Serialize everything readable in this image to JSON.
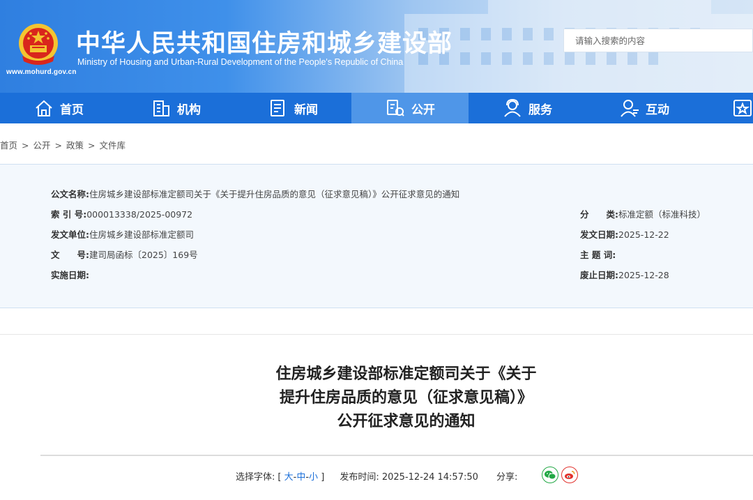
{
  "header": {
    "title_cn": "中华人民共和国住房和城乡建设部",
    "title_en": "Ministry of Housing and Urban-Rural Development of the People's Republic of China",
    "site_url": "www.mohurd.gov.cn",
    "search_placeholder": "请输入搜索的内容"
  },
  "nav": {
    "items": [
      {
        "label": "首页",
        "icon": "home-icon"
      },
      {
        "label": "机构",
        "icon": "building-icon"
      },
      {
        "label": "新闻",
        "icon": "news-icon"
      },
      {
        "label": "公开",
        "icon": "open-doc-icon",
        "active": true
      },
      {
        "label": "服务",
        "icon": "service-user-icon"
      },
      {
        "label": "互动",
        "icon": "interact-user-icon"
      }
    ]
  },
  "breadcrumb": [
    "首页",
    "公开",
    "政策",
    "文件库"
  ],
  "breadcrumb_sep": ">",
  "info": {
    "doc_name_label": "公文名称:",
    "doc_name": "住房城乡建设部标准定额司关于《关于提升住房品质的意见（征求意见稿）》公开征求意见的通知",
    "index_label": "索 引 号:",
    "index": "000013338/2025-00972",
    "category_label": "分　　类:",
    "category": "标准定额（标准科技）",
    "issuer_label": "发文单位:",
    "issuer": "住房城乡建设部标准定额司",
    "issue_date_label": "发文日期:",
    "issue_date": "2025-12-22",
    "doc_no_label": "文　　号:",
    "doc_no": "建司局函标〔2025〕169号",
    "keywords_label": "主 题 词:",
    "keywords": "",
    "effective_label": "实施日期:",
    "effective": "",
    "expiry_label": "废止日期:",
    "expiry": "2025-12-28"
  },
  "article": {
    "title_line1": "住房城乡建设部标准定额司关于《关于",
    "title_line2": "提升住房品质的意见（征求意见稿）》",
    "title_line3": "公开征求意见的通知",
    "font_label": "选择字体:",
    "font_open": "[",
    "font_large": "大",
    "font_medium": "中",
    "font_small": "小",
    "font_dash": "-",
    "font_close": "]",
    "publish_label": "发布时间:",
    "publish_time": "2025-12-24 14:57:50",
    "share_label": "分享:"
  },
  "colors": {
    "nav_bg": "#1b6fd9",
    "nav_active": "#4f96e8",
    "wechat": "#22a845",
    "weibo": "#e2322d"
  }
}
